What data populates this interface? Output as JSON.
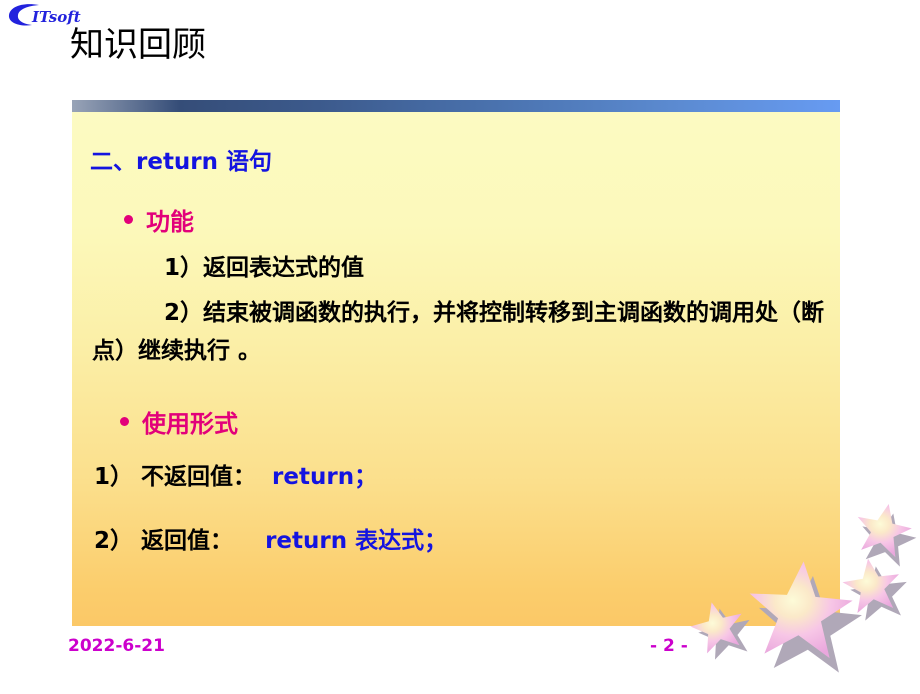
{
  "logo": {
    "text": "ITsoft",
    "color": "#2222dd",
    "icon": "swoosh-c-logo"
  },
  "slide": {
    "title": "知识回顾",
    "title_color": "#000000"
  },
  "panel": {
    "bar_gradient_from": "#2b3f63",
    "bar_gradient_to": "#679bf2",
    "body_gradient_from": "#fcfac2",
    "body_gradient_to": "#fbc867",
    "heading": {
      "prefix": "二、",
      "keyword": "return",
      "suffix": " 语句",
      "color": "#1414e0"
    },
    "bullets": [
      {
        "label": "功能",
        "color": "#e2007a"
      },
      {
        "label": "使用形式",
        "color": "#e2007a"
      }
    ],
    "function_items": [
      "1）返回表达式的值",
      "2）结束被调函数的执行，并将控制转移到主调函数的调用处（断点）继续执行 。"
    ],
    "forms": [
      {
        "index": "1）",
        "label": "不返回值：",
        "keyword": "return",
        "expression": "",
        "terminator": "；"
      },
      {
        "index": "2）",
        "label": "返回值：",
        "keyword": "return",
        "expression": "表达式",
        "terminator": "；"
      }
    ],
    "keyword_color": "#1414e0"
  },
  "footer": {
    "date": "2022-6-21",
    "page": "- 2 -",
    "color": "#cc00cc"
  },
  "decoration": {
    "stars_icon": "star-cluster",
    "star_fill": "#f3b8e8",
    "star_highlight": "#fdfbd0",
    "star_shadow": "#b0a8b8",
    "count": 4
  }
}
